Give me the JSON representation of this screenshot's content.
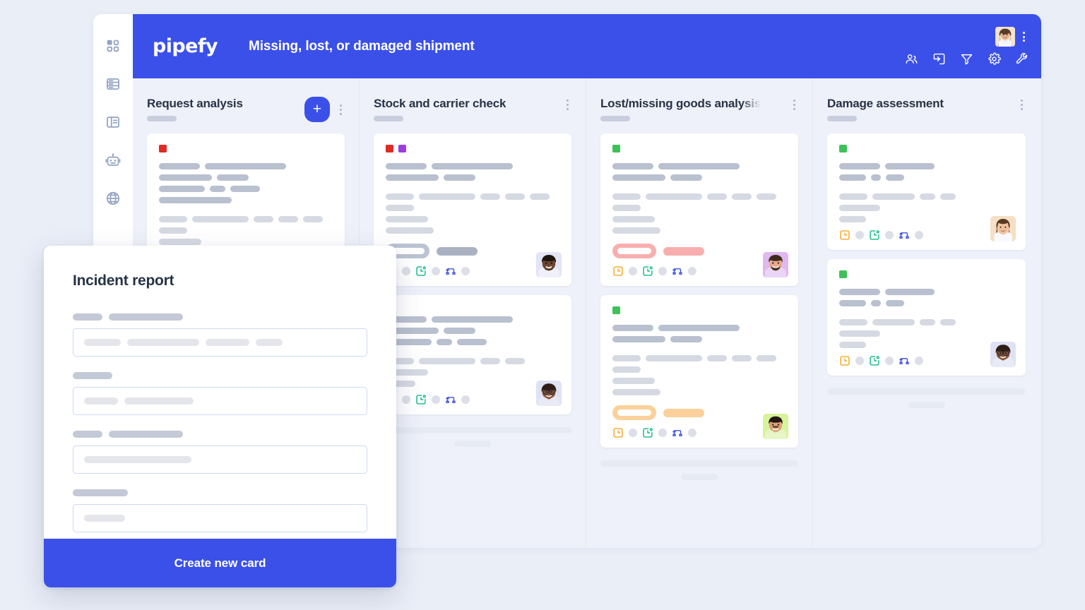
{
  "app": {
    "brand": "pipefy",
    "board_title": "Missing, lost, or damaged shipment",
    "accent_color": "#3B50E8",
    "background_color": "#eaeef7",
    "board_background": "#eef1f9"
  },
  "sidebar": {
    "items": [
      {
        "icon": "grid-dashboard-icon",
        "name": "sidebar-item-dashboard"
      },
      {
        "icon": "database-icon",
        "name": "sidebar-item-database"
      },
      {
        "icon": "layout-template-icon",
        "name": "sidebar-item-templates"
      },
      {
        "icon": "robot-automation-icon",
        "name": "sidebar-item-automation"
      },
      {
        "icon": "globe-icon",
        "name": "sidebar-item-portal"
      }
    ]
  },
  "topbar": {
    "avatar": "user-avatar",
    "menu_icon": "kebab-menu-icon",
    "tools": [
      {
        "icon": "members-icon",
        "name": "members-button"
      },
      {
        "icon": "import-icon",
        "name": "import-button"
      },
      {
        "icon": "filter-icon",
        "name": "filter-button"
      },
      {
        "icon": "gear-icon",
        "name": "settings-button"
      },
      {
        "icon": "wrench-icon",
        "name": "tools-button"
      }
    ]
  },
  "board": {
    "add_card_label": "+",
    "columns": [
      {
        "title": "Request analysis",
        "has_add_button": true,
        "truncated": false,
        "cards": [
          {
            "tags": [
              "#e02b25"
            ],
            "lines": [
              [
                58,
                115,
                75,
                45
              ],
              [
                65,
                22,
                42,
                103
              ]
            ],
            "lines2": [
              [
                40,
                80,
                28,
                28,
                28,
                40
              ]
            ],
            "bars": [
              60,
              68
            ],
            "badge": null,
            "footer_icons": [
              "due-date-icon",
              "checklist-icon",
              "connection-icon"
            ],
            "avatar": "avatar-1"
          }
        ],
        "ghost": true
      },
      {
        "title": "Stock and carrier check",
        "has_add_button": false,
        "truncated": false,
        "cards": [
          {
            "tags": [
              "#e02b25",
              "#9c3de0"
            ],
            "lines": [
              [
                58,
                115,
                75,
                45
              ]
            ],
            "lines2": [
              [
                40,
                80,
                28,
                28,
                28,
                40
              ]
            ],
            "bars": [
              60,
              68
            ],
            "badge": {
              "pill": "#bcc3d1",
              "bar": "#aab2c2"
            },
            "footer_icons": [
              "due-date-icon",
              "checklist-icon",
              "connection-icon"
            ],
            "avatar": "avatar-2"
          },
          {
            "tags": [],
            "lines": [
              [
                58,
                115,
                75,
                45
              ]
            ],
            "lines2": [
              [
                40,
                80,
                28,
                28,
                28,
                40
              ]
            ],
            "bars": [
              60,
              68
            ],
            "badge": null,
            "footer_icons": [
              "due-date-icon",
              "checklist-icon",
              "connection-icon"
            ],
            "avatar": "avatar-3"
          }
        ],
        "ghost": true
      },
      {
        "title": "Lost/missing goods analysis",
        "has_add_button": false,
        "truncated": true,
        "cards": [
          {
            "tags": [
              "#3dc159"
            ],
            "lines": [
              [
                58,
                115,
                75,
                45
              ]
            ],
            "lines2": [
              [
                40,
                80,
                28,
                28,
                28,
                40
              ]
            ],
            "bars": [
              60,
              68
            ],
            "badge": {
              "pill": "#f8aeae",
              "bar": "#f8aeae"
            },
            "footer_icons": [
              "due-date-icon",
              "checklist-icon",
              "connection-icon"
            ],
            "avatar": "avatar-4"
          },
          {
            "tags": [
              "#3dc159"
            ],
            "lines": [
              [
                58,
                115,
                75,
                45
              ]
            ],
            "lines2": [
              [
                40,
                80,
                28,
                28,
                28,
                40
              ]
            ],
            "bars": [
              60,
              68
            ],
            "badge": {
              "pill": "#fbd09a",
              "bar": "#fbd09a"
            },
            "footer_icons": [
              "due-date-icon",
              "checklist-icon",
              "connection-icon"
            ],
            "avatar": "avatar-5"
          }
        ],
        "ghost": true
      },
      {
        "title": "Damage assessment",
        "has_add_button": false,
        "truncated": false,
        "cards": [
          {
            "tags": [
              "#3dc159"
            ],
            "lines": [
              [
                58,
                115,
                75,
                45
              ]
            ],
            "lines2": [
              [
                40,
                80,
                28,
                28,
                28,
                40
              ]
            ],
            "bars": [
              60,
              68
            ],
            "badge": null,
            "footer_icons": [
              "due-date-icon",
              "checklist-icon",
              "connection-icon"
            ],
            "avatar": "avatar-6"
          },
          {
            "tags": [
              "#3dc159"
            ],
            "lines": [
              [
                58,
                115,
                75,
                45
              ]
            ],
            "lines2": [
              [
                40,
                80,
                28,
                28,
                28,
                40
              ]
            ],
            "bars": [
              60,
              68
            ],
            "badge": null,
            "footer_icons": [
              "due-date-icon",
              "checklist-icon",
              "connection-icon"
            ],
            "avatar": "avatar-7"
          }
        ],
        "ghost": true
      }
    ]
  },
  "modal": {
    "title": "Incident report",
    "submit_label": "Create new card",
    "fields": [
      {
        "label_widths": [
          42,
          105
        ],
        "value_widths": [
          52,
          102,
          62,
          38
        ]
      },
      {
        "label_widths": [
          56
        ],
        "value_widths": [
          48,
          98
        ]
      },
      {
        "label_widths": [
          42,
          105
        ],
        "value_widths": [
          152
        ]
      },
      {
        "label_widths": [
          78
        ],
        "value_widths": [
          58
        ]
      }
    ]
  }
}
